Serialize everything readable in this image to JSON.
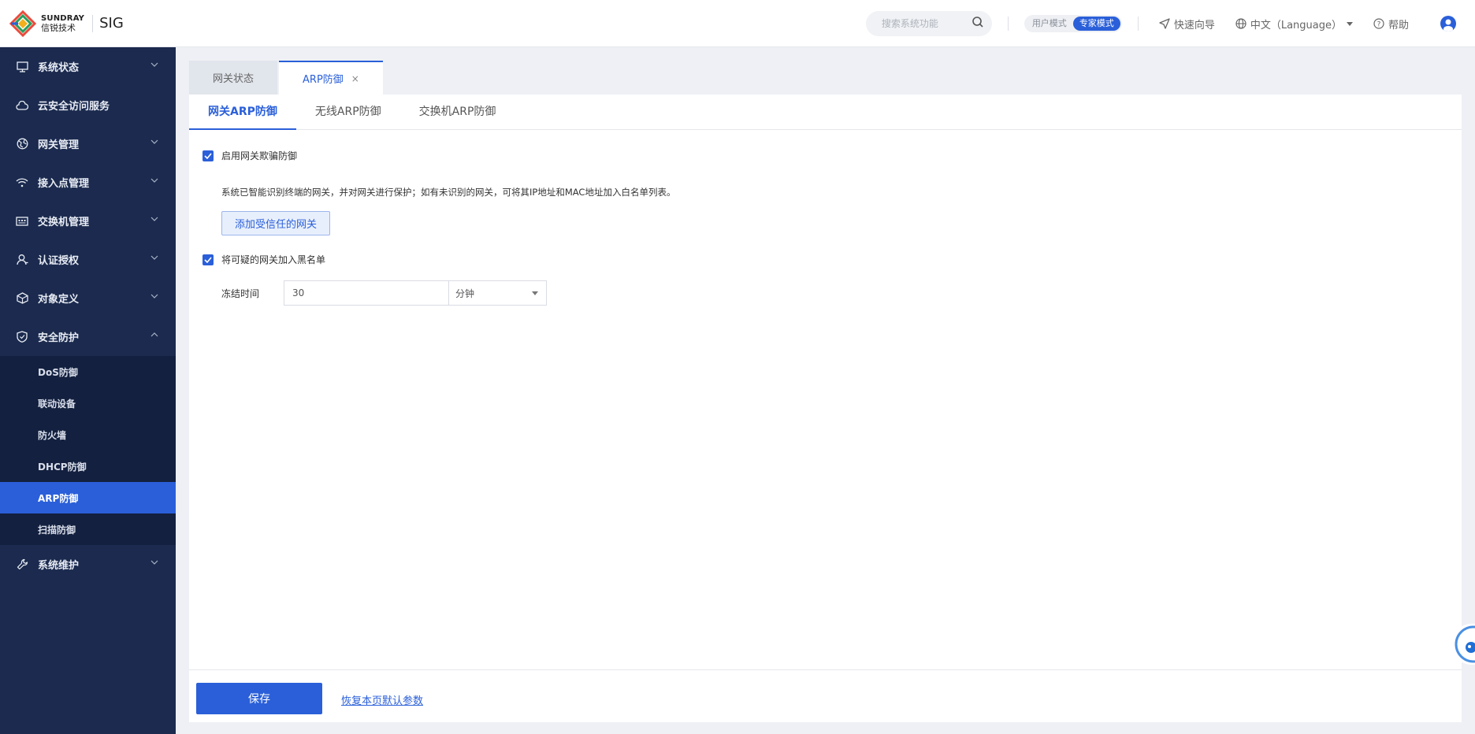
{
  "header": {
    "logo_en": "SUNDRAY",
    "logo_cn": "信锐技术",
    "product": "SIG",
    "search_placeholder": "搜索系统功能",
    "modes": [
      "用户模式",
      "专家模式"
    ],
    "active_mode": "专家模式",
    "quick_guide": "快速向导",
    "language": "中文（Language）",
    "help": "帮助"
  },
  "sidebar": {
    "items": [
      {
        "label": "系统状态",
        "icon": "monitor-icon",
        "expanded": false
      },
      {
        "label": "云安全访问服务",
        "icon": "cloud-icon",
        "expanded": false
      },
      {
        "label": "网关管理",
        "icon": "globe-icon",
        "expanded": false
      },
      {
        "label": "接入点管理",
        "icon": "wifi-icon",
        "expanded": false
      },
      {
        "label": "交换机管理",
        "icon": "switch-icon",
        "expanded": false
      },
      {
        "label": "认证授权",
        "icon": "user-icon",
        "expanded": false
      },
      {
        "label": "对象定义",
        "icon": "cube-icon",
        "expanded": false
      },
      {
        "label": "安全防护",
        "icon": "shield-icon",
        "expanded": true
      },
      {
        "label": "系统维护",
        "icon": "wrench-icon",
        "expanded": false
      }
    ],
    "security_sub": [
      "DoS防御",
      "联动设备",
      "防火墙",
      "DHCP防御",
      "ARP防御",
      "扫描防御"
    ],
    "active_sub": "ARP防御"
  },
  "page_tabs": [
    {
      "label": "网关状态",
      "active": false
    },
    {
      "label": "ARP防御",
      "active": true,
      "close": "×"
    }
  ],
  "sub_tabs": [
    {
      "label": "网关ARP防御",
      "active": true
    },
    {
      "label": "无线ARP防御",
      "active": false
    },
    {
      "label": "交换机ARP防御",
      "active": false
    }
  ],
  "form": {
    "enable_label": "启用网关欺骗防御",
    "enable_checked": true,
    "description": "系统已智能识别终端的网关，并对网关进行保护；如有未识别的网关，可将其IP地址和MAC地址加入白名单列表。",
    "add_trusted_button": "添加受信任的网关",
    "blacklist_label": "将可疑的网关加入黑名单",
    "blacklist_checked": true,
    "freeze_label": "冻结时间",
    "freeze_value": "30",
    "freeze_unit": "分钟"
  },
  "footer": {
    "save_button": "保存",
    "reset_link": "恢复本页默认参数"
  },
  "colors": {
    "accent": "#2a5fd9",
    "sidebar_bg": "#1b2a4e",
    "submenu_bg": "#13203f"
  }
}
